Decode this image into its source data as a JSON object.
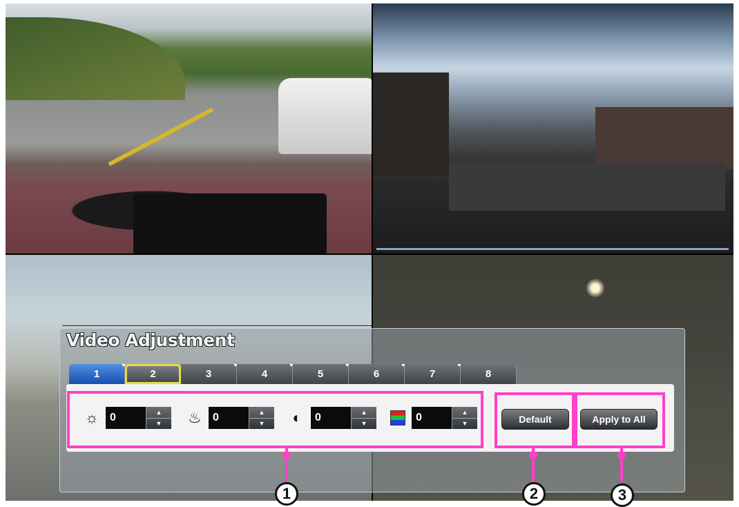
{
  "panel": {
    "title": "Video Adjustment"
  },
  "tabs": [
    {
      "label": "1",
      "state": "active"
    },
    {
      "label": "2",
      "state": "selected"
    },
    {
      "label": "3"
    },
    {
      "label": "4"
    },
    {
      "label": "5"
    },
    {
      "label": "6"
    },
    {
      "label": "7"
    },
    {
      "label": "8"
    }
  ],
  "controls": [
    {
      "name": "brightness",
      "icon": "sun-icon",
      "value": "0"
    },
    {
      "name": "saturation",
      "icon": "color-saturation-icon",
      "value": "0"
    },
    {
      "name": "contrast",
      "icon": "contrast-icon",
      "value": "0"
    },
    {
      "name": "hue",
      "icon": "rgb-color-icon",
      "value": "0"
    }
  ],
  "buttons": {
    "default_label": "Default",
    "apply_all_label": "Apply to All"
  },
  "callouts": {
    "c1": "1",
    "c2": "2",
    "c3": "3"
  },
  "colors": {
    "highlight": "#ff40c8",
    "tab_active": "#1a4fb0",
    "tab_selected_border": "#e7d94a"
  }
}
